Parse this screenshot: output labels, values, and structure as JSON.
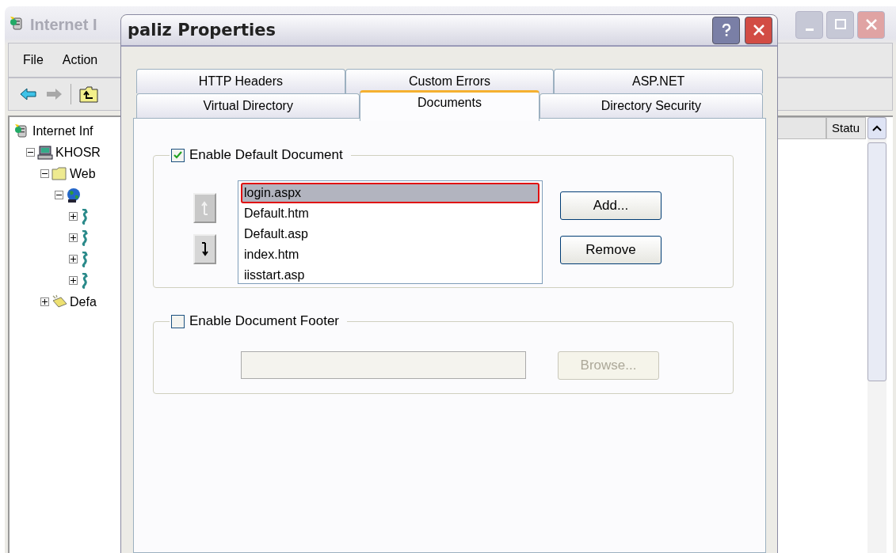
{
  "background_window": {
    "title": "Internet I",
    "menu": [
      "File",
      "Action"
    ],
    "tree": [
      {
        "label": "Internet Inf",
        "kind": "server",
        "children": [
          {
            "label": "KHOSR",
            "kind": "computer",
            "expanded": true,
            "children": [
              {
                "label": "Web",
                "kind": "folder",
                "expanded": true,
                "children": [
                  {
                    "kind": "globe",
                    "expanded": true,
                    "children": [
                      {
                        "expanded": false
                      },
                      {
                        "expanded": false
                      },
                      {
                        "expanded": false
                      },
                      {
                        "expanded": false
                      }
                    ]
                  }
                ]
              },
              {
                "label": "Defa",
                "kind": "envelope",
                "expanded": false
              }
            ]
          }
        ]
      }
    ],
    "columns": [
      "Statu"
    ]
  },
  "dialog": {
    "title": "paliz Properties",
    "tab_rows": [
      [
        {
          "label": "HTTP Headers",
          "selected": false
        },
        {
          "label": "Custom Errors",
          "selected": false
        },
        {
          "label": "ASP.NET",
          "selected": false
        }
      ],
      [
        {
          "label": "Virtual Directory",
          "selected": false
        },
        {
          "label": "Documents",
          "selected": true
        },
        {
          "label": "Directory Security",
          "selected": false
        }
      ]
    ],
    "default_document": {
      "label": "Enable Default Document",
      "checked": true,
      "documents": [
        {
          "name": "login.aspx",
          "selected": true
        },
        {
          "name": "Default.htm",
          "selected": false
        },
        {
          "name": "Default.asp",
          "selected": false
        },
        {
          "name": "index.htm",
          "selected": false
        },
        {
          "name": "iisstart.asp",
          "selected": false
        }
      ],
      "move_buttons": [
        {
          "kind": "up",
          "disabled": true
        },
        {
          "kind": "down",
          "disabled": false
        }
      ],
      "buttons": [
        {
          "label": "Add...",
          "disabled": false
        },
        {
          "label": "Remove",
          "disabled": false
        }
      ]
    },
    "document_footer": {
      "label": "Enable Document Footer",
      "checked": false,
      "field_disabled": true,
      "browse": {
        "label": "Browse...",
        "disabled": true
      }
    }
  }
}
